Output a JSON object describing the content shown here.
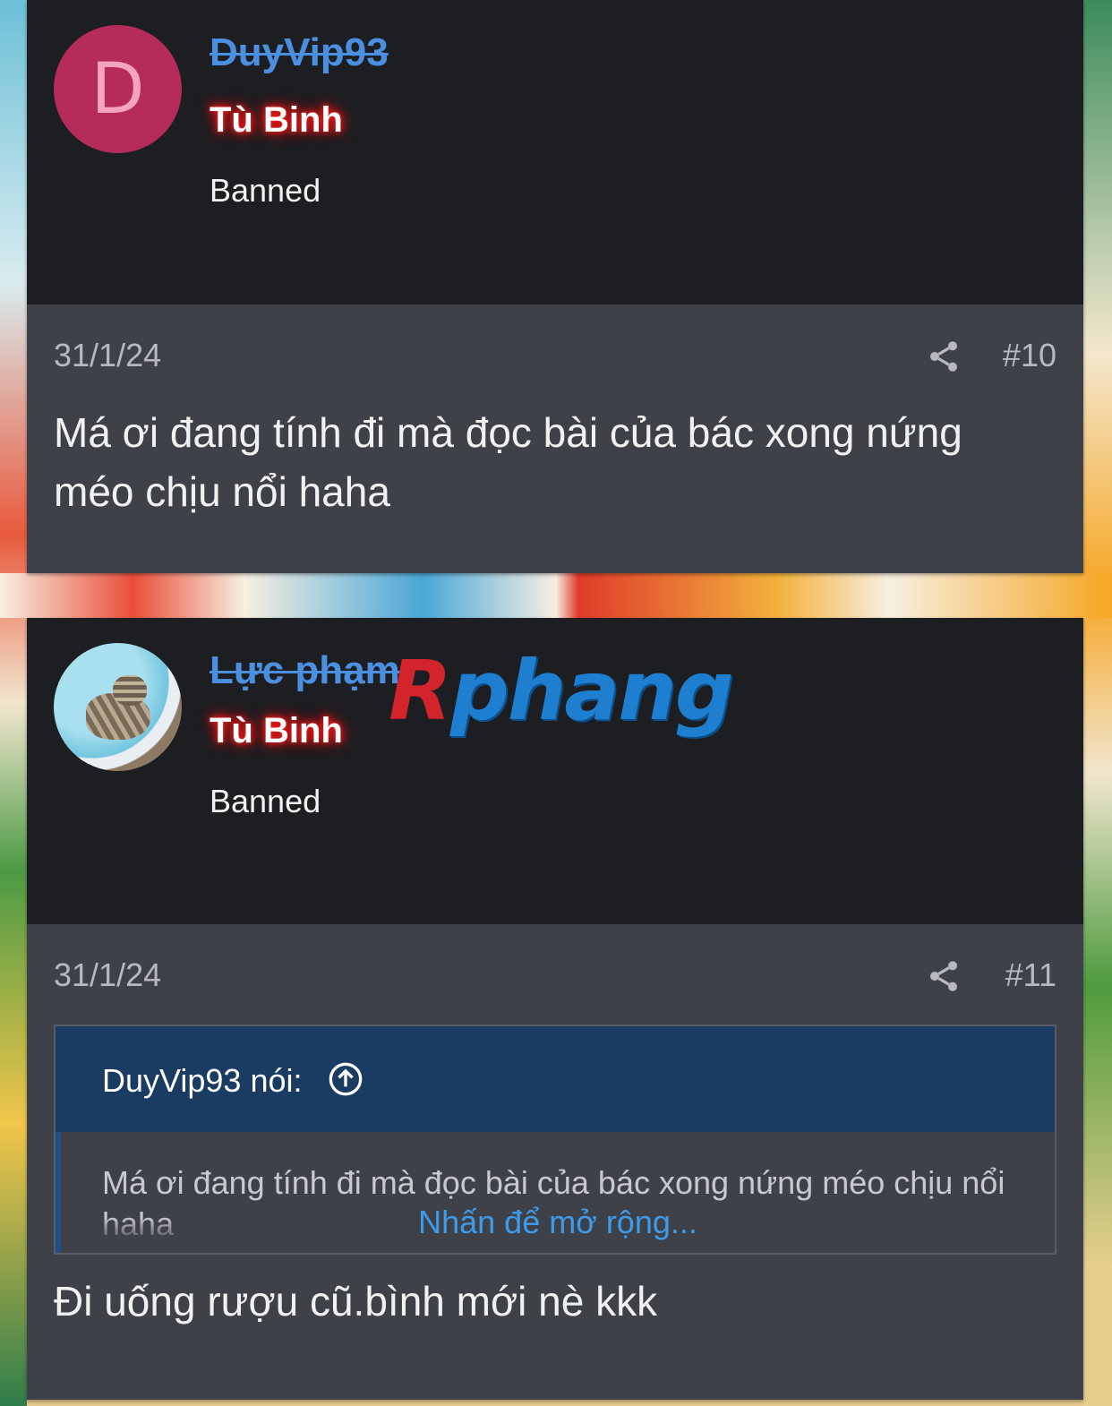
{
  "posts": [
    {
      "avatar_letter": "D",
      "username": "DuyVip93",
      "user_title": "Tù Binh",
      "user_banner": "Banned",
      "date": "31/1/24",
      "post_number": "#10",
      "share_icon": "share-icon",
      "body": "Má ơi đang tính đi mà đọc bài của bác xong nứng méo chịu nổi haha"
    },
    {
      "avatar_image": "cat-photo",
      "username": "Lực phạm",
      "user_title": "Tù Binh",
      "user_banner": "Banned",
      "date": "31/1/24",
      "post_number": "#11",
      "share_icon": "share-icon",
      "quote": {
        "author_line": "DuyVip93 nói:",
        "jump_icon": "arrow-up-circle-icon",
        "text": "Má ơi đang tính đi mà đọc bài của bác xong nứng méo chịu nổi haha",
        "expand_label": "Nhấn để mở rộng..."
      },
      "body": "Đi uống rượu cũ.bình mới nè kkk"
    }
  ],
  "watermark": {
    "first": "R",
    "rest": "phang"
  },
  "colors": {
    "user_block_bg": "#1d1e22",
    "content_bg": "#3f4148",
    "username": "#4a8fe0",
    "title_glow": "#ff1a1a",
    "quote_header_bg": "#1a3b62",
    "link": "#3d9be9"
  }
}
